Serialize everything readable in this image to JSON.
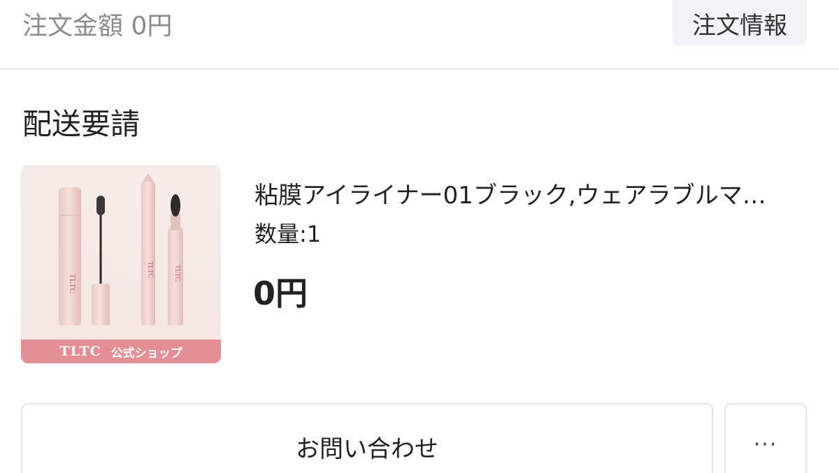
{
  "header": {
    "order_amount": "注文金額 0円",
    "order_info_button": "注文情報"
  },
  "section": {
    "title": "配送要請"
  },
  "product": {
    "name": "粘膜アイライナー01ブラック,ウェアラブルマ…",
    "quantity": "数量:1",
    "price": "0円",
    "image": {
      "shop_brand": "TLTC",
      "shop_label": "公式ショップ",
      "product_brand": "TLTC"
    }
  },
  "actions": {
    "contact_button": "お問い合わせ",
    "more_button": "···",
    "more_icon": "ellipsis-icon"
  },
  "colors": {
    "background": "#ffffff",
    "muted_text": "#8a8a8f",
    "button_bg": "#f3f3f8",
    "border": "#e2e2e6",
    "shop_band": "#e48e96",
    "product_pink": "#f0d4cf"
  }
}
